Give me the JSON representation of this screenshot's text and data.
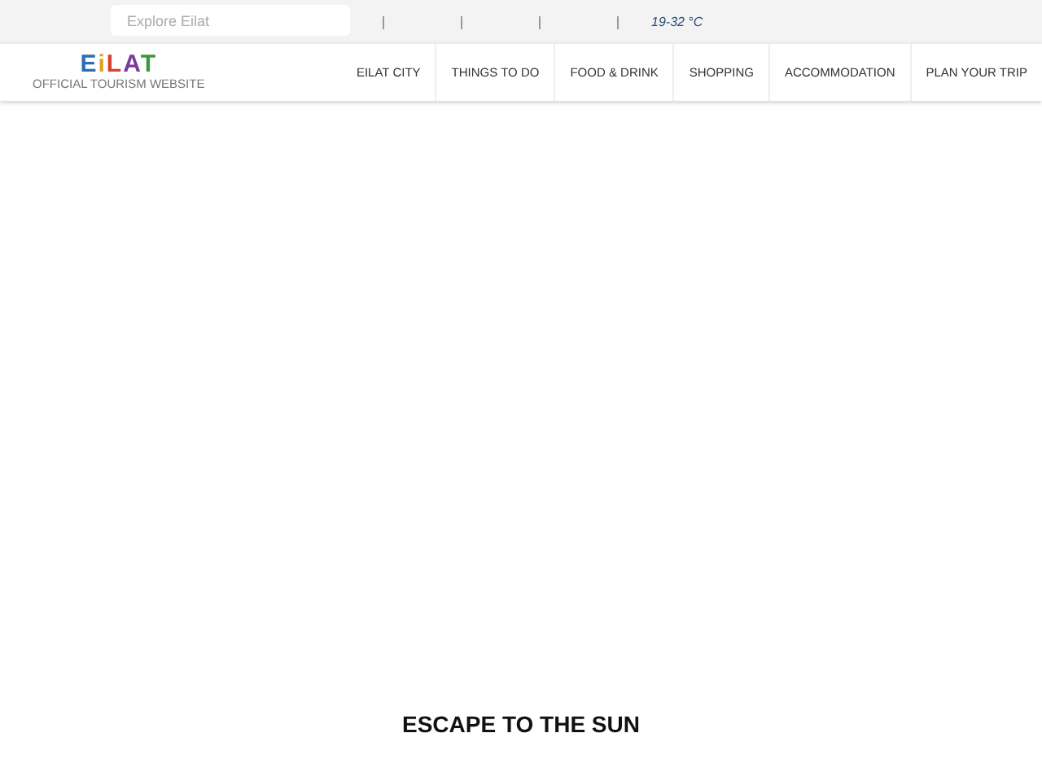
{
  "top_bar": {
    "search": {
      "placeholder": "Explore Eilat"
    },
    "weather": "19-32 °C"
  },
  "header": {
    "logo": {
      "letters": [
        {
          "text": "E",
          "color": "#2a6fb5"
        },
        {
          "text": "i",
          "color": "#e0a020"
        },
        {
          "text": "L",
          "color": "#d8402a"
        },
        {
          "text": "A",
          "color": "#7a3a9a"
        },
        {
          "text": "T",
          "color": "#3a9a3a"
        }
      ],
      "tagline": "OFFICIAL TOURISM WEBSITE"
    },
    "nav": [
      {
        "label": "EILAT CITY"
      },
      {
        "label": "THINGS TO DO"
      },
      {
        "label": "FOOD & DRINK"
      },
      {
        "label": "SHOPPING"
      },
      {
        "label": "ACCOMMODATION"
      },
      {
        "label": "PLAN YOUR TRIP"
      }
    ]
  },
  "hero": {
    "heading": "ESCAPE TO THE SUN"
  }
}
